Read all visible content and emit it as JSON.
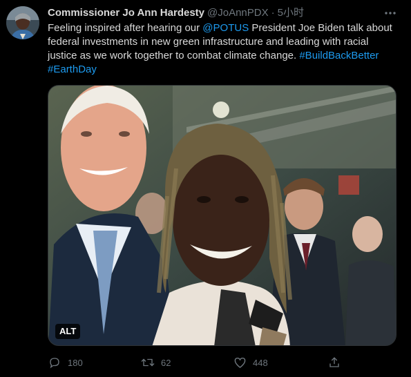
{
  "author": {
    "display_name": "Commissioner Jo Ann Hardesty",
    "handle": "@JoAnnPDX",
    "separator": "·",
    "time": "5小时"
  },
  "tweet": {
    "text_1": "Feeling inspired after hearing our ",
    "mention": "@POTUS",
    "text_2": " President Joe Biden talk about federal investments in new green infrastructure and leading with racial justice as we work together to combat climate change. ",
    "hashtag_1": "#BuildBackBetter",
    "hashtag_2": "#EarthDay"
  },
  "media": {
    "alt_label": "ALT"
  },
  "actions": {
    "reply_count": "180",
    "retweet_count": "62",
    "like_count": "448"
  },
  "colors": {
    "background": "#000000",
    "text": "#d9d9d9",
    "secondary": "#6e767d",
    "link": "#1d9bf0"
  },
  "icons": [
    "more-icon",
    "reply-icon",
    "retweet-icon",
    "like-icon",
    "share-icon"
  ]
}
